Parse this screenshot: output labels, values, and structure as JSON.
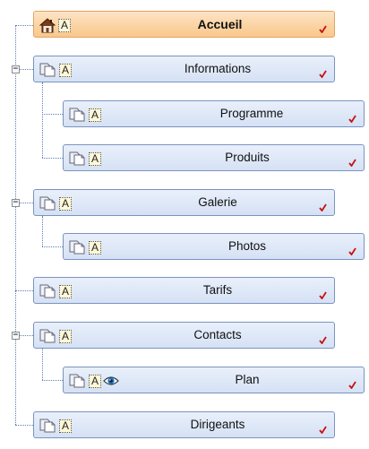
{
  "tree": {
    "nodes": [
      {
        "label": "Accueil",
        "icon": "home-icon"
      },
      {
        "label": "Informations",
        "icon": "page-icon",
        "toggle": "−"
      },
      {
        "label": "Programme",
        "icon": "page-icon"
      },
      {
        "label": "Produits",
        "icon": "page-icon"
      },
      {
        "label": "Galerie",
        "icon": "page-icon",
        "toggle": "−"
      },
      {
        "label": "Photos",
        "icon": "page-icon"
      },
      {
        "label": "Tarifs",
        "icon": "page-icon"
      },
      {
        "label": "Contacts",
        "icon": "page-icon",
        "toggle": "−"
      },
      {
        "label": "Plan",
        "icon": "page-icon",
        "extra_icon": "eye-icon"
      },
      {
        "label": "Dirigeants",
        "icon": "page-icon"
      }
    ],
    "text_icon_label": "A"
  },
  "colors": {
    "home_bg": "#f9c78b",
    "node_bg": "#d5e1f4",
    "node_border": "#7b93c0",
    "connector": "#5b7fb8",
    "check": "#c81010"
  }
}
